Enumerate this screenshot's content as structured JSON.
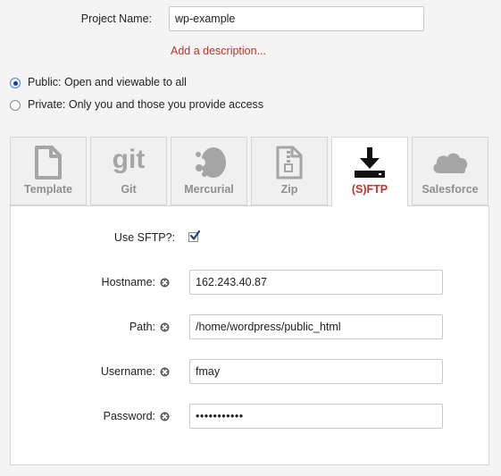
{
  "project": {
    "name_label": "Project Name:",
    "name_value": "wp-example",
    "add_description": "Add a description..."
  },
  "visibility": {
    "public_label": "Public: Open and viewable to all",
    "private_label": "Private: Only you and those you provide access",
    "selected": "public"
  },
  "tabs": [
    {
      "label": "Template",
      "icon": "document-icon"
    },
    {
      "label": "Git",
      "icon": "git-icon"
    },
    {
      "label": "Mercurial",
      "icon": "mercurial-icon"
    },
    {
      "label": "Zip",
      "icon": "zip-file-icon"
    },
    {
      "label": "(S)FTP",
      "icon": "download-icon",
      "active": true
    },
    {
      "label": "Salesforce",
      "icon": "cloud-icon"
    }
  ],
  "sftp": {
    "use_sftp_label": "Use SFTP?:",
    "use_sftp_checked": true,
    "hostname_label": "Hostname:",
    "hostname_value": "162.243.40.87",
    "path_label": "Path:",
    "path_value": "/home/wordpress/public_html",
    "username_label": "Username:",
    "username_value": "fmay",
    "password_label": "Password:",
    "password_value": "•••••••••••"
  },
  "colors": {
    "accent_red": "#c4302b",
    "tab_inactive_text": "#8f8f8f",
    "checkbox_tick": "#1f3f8f"
  }
}
